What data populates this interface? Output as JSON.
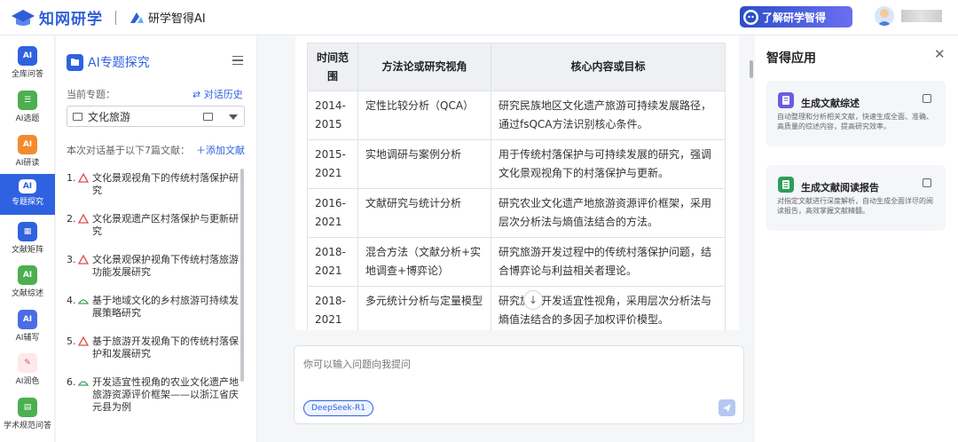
{
  "header": {
    "brand": "知网研学",
    "sub_brand": "研学智得AI",
    "learn_button": "了解研学智得"
  },
  "left_nav": [
    {
      "label": "全库问答",
      "icon": "AI",
      "color": "#2f62e0"
    },
    {
      "label": "AI选题",
      "icon": "☰",
      "color": "#4caf50"
    },
    {
      "label": "AI研读",
      "icon": "AI",
      "color": "#f28b2e"
    },
    {
      "label": "专题探究",
      "icon": "AI",
      "color": "#2f62e0"
    },
    {
      "label": "文献矩阵",
      "icon": "▦",
      "color": "#2f62e0"
    },
    {
      "label": "文献综述",
      "icon": "AI",
      "color": "#4caf50"
    },
    {
      "label": "AI辅写",
      "icon": "AI",
      "color": "#4a6de5"
    },
    {
      "label": "AI润色",
      "icon": "✎",
      "color": "#e84c5c"
    },
    {
      "label": "学术规范问答",
      "icon": "▤",
      "color": "#4caf50"
    }
  ],
  "topic_panel": {
    "title": "AI专题探究",
    "current_topic_label": "当前专题：",
    "history_link": "⇄ 对话历史",
    "topic_value": "文化旅游",
    "based_on": "本次对话基于以下7篇文献：",
    "add_literature": "＋添加文献",
    "literature": [
      {
        "num": "1.",
        "title": "文化景观视角下的传统村落保护研究",
        "icon": "pdf"
      },
      {
        "num": "2.",
        "title": "文化景观遗产区村落保护与更新研究",
        "icon": "pdf"
      },
      {
        "num": "3.",
        "title": "文化景观保护视角下传统村落旅游功能发展研究",
        "icon": "pdf"
      },
      {
        "num": "4.",
        "title": "基于地域文化的乡村旅游可持续发展策略研究",
        "icon": "doc"
      },
      {
        "num": "5.",
        "title": "基于旅游开发视角下的传统村落保护和发展研究",
        "icon": "pdf"
      },
      {
        "num": "6.",
        "title": "开发适宜性视角的农业文化遗产地旅游资源评价框架——以浙江省庆元县为例",
        "icon": "doc"
      }
    ]
  },
  "table": {
    "headers": [
      "时间范围",
      "方法论或研究视角",
      "核心内容或目标"
    ],
    "rows": [
      {
        "period": "2014-2015",
        "method": "定性比较分析（QCA）",
        "content": "研究民族地区文化遗产旅游可持续发展路径，通过fsQCA方法识别核心条件。"
      },
      {
        "period": "2015-2021",
        "method": "实地调研与案例分析",
        "content": "用于传统村落保护与可持续发展的研究，强调文化景观视角下的村落保护与更新。"
      },
      {
        "period": "2016-2021",
        "method": "文献研究与统计分析",
        "content": "研究农业文化遗产地旅游资源评价框架，采用层次分析法与熵值法结合的方法。"
      },
      {
        "period": "2018-2021",
        "method": "混合方法（文献分析+实地调查+博弈论）",
        "content": "研究旅游开发过程中的传统村落保护问题，结合博弈论与利益相关者理论。"
      },
      {
        "period": "2018-2021",
        "method": "多元统计分析与定量模型",
        "content": "研究旅游开发适宜性视角，采用层次分析法与熵值法结合的多因子加权评价模型。"
      }
    ]
  },
  "chat": {
    "placeholder": "你可以输入问题向我提问",
    "model": "DeepSeek-R1"
  },
  "right_panel": {
    "title": "智得应用",
    "apps": [
      {
        "title": "生成文献综述",
        "desc": "自动整理和分析相关文献，快速生成全面、准确、高质量的综述内容，提高研究效率。",
        "color": "#6b5be0"
      },
      {
        "title": "生成文献阅读报告",
        "desc": "对指定文献进行深度解析，自动生成全面详尽的阅读报告，高效掌握文献精髓。",
        "color": "#2e9d5a"
      }
    ]
  }
}
